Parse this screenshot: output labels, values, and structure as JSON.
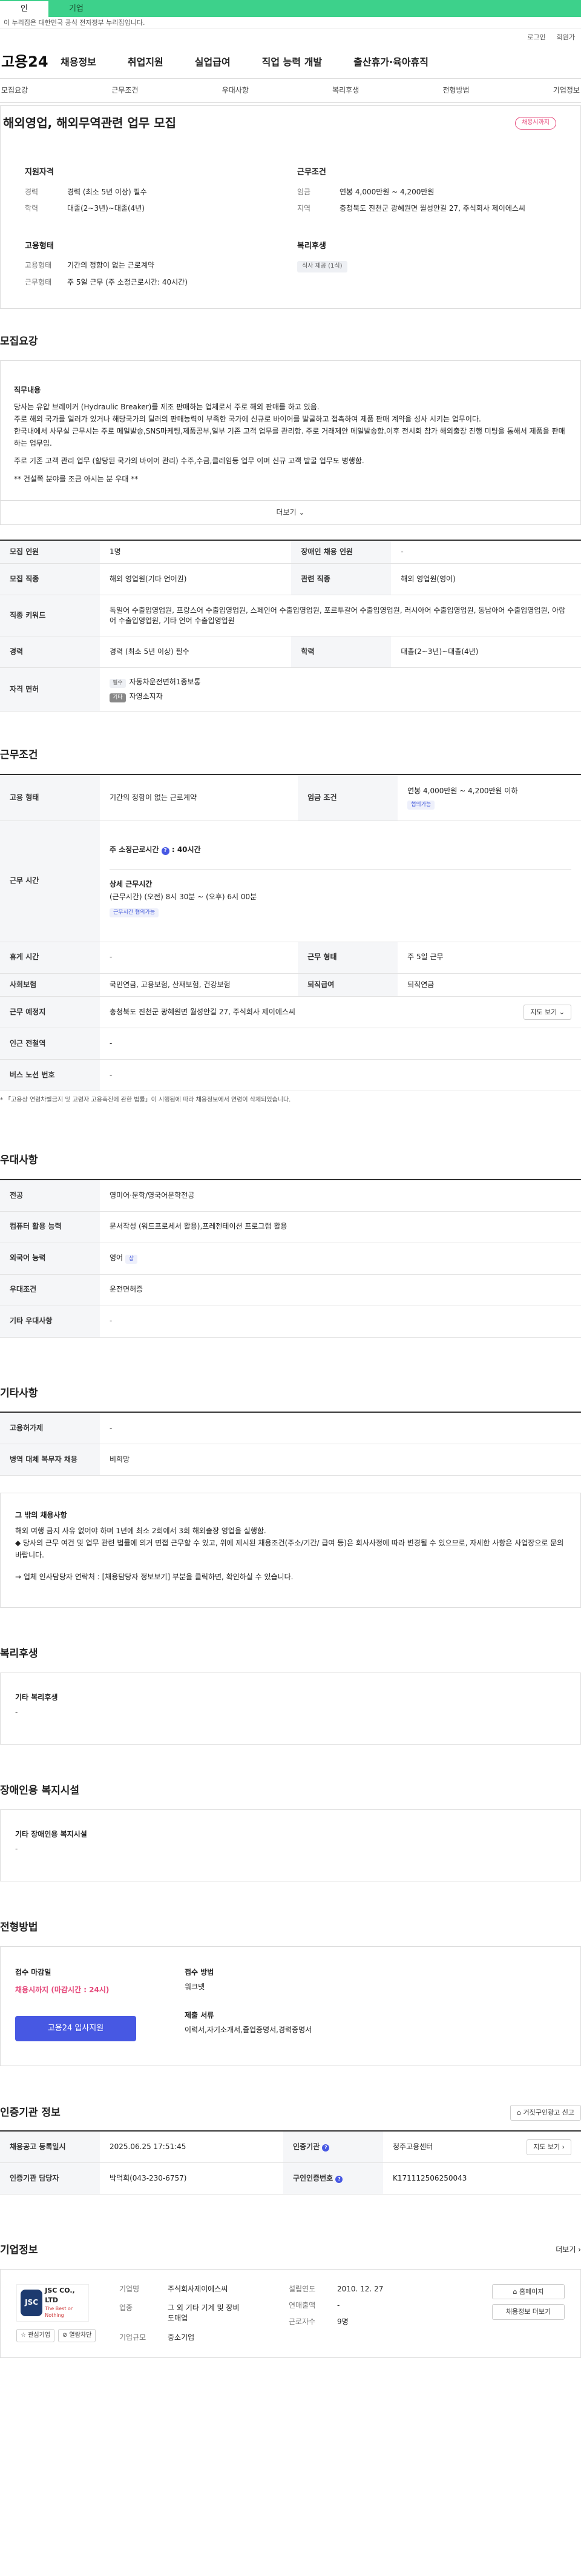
{
  "topbar": {
    "tab_individual": "인",
    "tab_company": "기업"
  },
  "notice": "이 누리집은 대한민국 공식 전자정부 누리집입니다.",
  "util": [
    "로그인",
    "회원가"
  ],
  "gnb": {
    "logo": "고용24",
    "items": [
      "채용정보",
      "취업지원",
      "실업급여",
      "직업 능력 개발",
      "출산휴가·육아휴직"
    ]
  },
  "subnav": [
    "모집요강",
    "근무조건",
    "우대사항",
    "복리후생",
    "전형방법",
    "기업정보"
  ],
  "hero": {
    "title": "해외영업, 해외무역관련 업무 모집",
    "badge": "채용시까지",
    "qual": {
      "heading": "지원자격",
      "rows": [
        {
          "k": "경력",
          "v": "경력 (최소 5년 이상) 필수"
        },
        {
          "k": "학력",
          "v": "대졸(2~3년)~대졸(4년)"
        }
      ]
    },
    "cond": {
      "heading": "근무조건",
      "rows": [
        {
          "k": "임금",
          "v": "연봉 4,000만원 ~ 4,200만원"
        },
        {
          "k": "지역",
          "v": "충청북도 진천군 광혜원면 월성안길 27, 주식회사 제이에스씨"
        }
      ]
    },
    "emp": {
      "heading": "고용형태",
      "rows": [
        {
          "k": "고용형태",
          "v": "기간의 정함이 없는 근로계약"
        },
        {
          "k": "근무형태",
          "v": "주 5일 근무 (주 소정근로시간: 40시간)"
        }
      ]
    },
    "welfare": {
      "heading": "복리후생",
      "chip": "식사 제공 (1식)"
    }
  },
  "recruit": {
    "heading": "모집요강",
    "duty_title": "직무내용",
    "duty_lines": [
      "당사는 유압 브레이커 (Hydraulic Breaker)를 제조 판매하는 업체로서 주로 해외 판매를 하고 있음.",
      "주로 해외 국가를 일러가 있거나 해당국가의 딜러의 판매능력이 부족한 국가에 신규로 바이어를 발굴하고 접촉하여 제품 판매 계약을 성사 시키는 업무이다.",
      "한국내에서 사무실 근무시는 주로 메일발송,SNS마케팅,제품공부,일부 기존 고객 업무를 관리함. 주로 거래제안 메일발송함.이후 전시회 참가 해외출장 진행 미팅을 통해서 제품을 판매하는 업무임.",
      "주로 기존 고객 관리 업무 (할당된 국가의 바이어 관리) 수주,수금,클레임등 업무 이며 신규 고객 발굴 업무도 병행함.",
      "** 건설쪽 분야를 조금 아시는 분 우대 **"
    ],
    "more": "더보기",
    "table": {
      "count_k": "모집 인원",
      "count_v": "1명",
      "disabled_k": "장애인 채용 인원",
      "disabled_v": "-",
      "job_k": "모집 직종",
      "job_v": "해외 영업원(기타 언어권)",
      "rel_k": "관련 직종",
      "rel_v": "해외 영업원(영어)",
      "kw_k": "직종 키워드",
      "kw_v": "독일어 수출입영업원, 프랑스어 수출입영업원, 스페인어 수출입영업원, 포르투갈어 수출입영업원, 러시아어 수출입영업원, 동남아어 수출입영업원, 아랍어 수출입영업원, 기타 언어 수출입영업원",
      "career_k": "경력",
      "career_v": "경력 (최소 5년 이상) 필수",
      "edu_k": "학력",
      "edu_v": "대졸(2~3년)~대졸(4년)",
      "lic_k": "자격 면허",
      "lic_rows": [
        {
          "chip": "필수",
          "text": "자동차운전면허1종보통"
        },
        {
          "chip": "기타",
          "text": "자영소지자"
        }
      ]
    }
  },
  "work": {
    "heading": "근무조건",
    "emp_k": "고용 형태",
    "emp_v": "기간의 정함이 없는 근로계약",
    "wage_k": "임금 조건",
    "wage_v": "연봉 4,000만원 ~ 4,200만원 이하",
    "wage_chip": "협의가능",
    "hours_k": "근무 시간",
    "hours_title": "주 소정근로시간",
    "hours_value": "40시간",
    "hours_detail_title": "상세 근무시간",
    "hours_detail": "(근무시간) (오전) 8시 30분 ~ (오후) 6시 00분",
    "hours_chip": "근무시간 협의가능",
    "break_k": "휴게 시간",
    "break_v": "-",
    "type_k": "근무 형태",
    "type_v": "주 5일 근무",
    "ins_k": "사회보험",
    "ins_v": "국민연금, 고용보험, 산재보험, 건강보험",
    "ret_k": "퇴직급여",
    "ret_v": "퇴직연금",
    "place_k": "근무 예정지",
    "place_v": "충청북도 진천군 광혜원면 월성안길 27, 주식회사 제이에스씨",
    "map_btn": "지도 보기",
    "sub_k": "인근 전철역",
    "sub_v": "-",
    "bus_k": "버스 노선 번호",
    "bus_v": "-",
    "foot": "* 「고용상 연령차별금지 및 고령자 고용촉진에 관한 법률」이 시행됨에 따라 채용정보에서 연령이 삭제되었습니다."
  },
  "pref": {
    "heading": "우대사항",
    "major_k": "전공",
    "major_v": "영미어·문학/영국어문학전공",
    "pc_k": "컴퓨터 활용 능력",
    "pc_v": "문서작성 (워드프로세서 활용),프레젠테이션 프로그램 활용",
    "lang_k": "외국어 능력",
    "lang_v": "영어",
    "lang_chip": "상",
    "cond_k": "우대조건",
    "cond_v": "운전면허증",
    "etc_k": "기타 우대사항",
    "etc_v": "-"
  },
  "etc": {
    "heading": "기타사항",
    "emp_k": "고용허가제",
    "emp_v": "-",
    "mil_k": "병역 대체 복무자 채용",
    "mil_v": "비희망",
    "box_title": "그 밖의 채용사항",
    "box_lines": [
      "해외 여행 금지 사유 없어야 하며 1년에 최소 2회에서 3회 해외출장 영업을 실행함.",
      "◆ 당사의 근무 여건 및 업무 관련 법률에 의거 면접 근무할 수 있고, 위에 제시된 채용조건(주소/기간/ 급여 등)은 회사사정에 따라 변경될 수 있으므로, 자세한 사항은 사업장으로 문의 바랍니다.",
      "→ 업체 인사담당자 연락처 : [채용담당자 정보보기] 부분을 클릭하면, 확인하실 수 있습니다."
    ]
  },
  "welfare": {
    "heading": "복리후생",
    "box_title": "기타 복리후생",
    "box_value": "-"
  },
  "disabled": {
    "heading": "장애인용 복지시설",
    "box_title": "기타 장애인용 복지시설",
    "box_value": "-"
  },
  "process": {
    "heading": "전형방법",
    "deadline_title": "접수 마감일",
    "deadline_value": "채용시까지 (마감시간 : 24시)",
    "apply_btn": "고용24 입사지원",
    "method_title": "접수 방법",
    "method_value": "워크넷",
    "docs_title": "제출 서류",
    "docs_value": "이력서,자기소개서,졸업증명서,경력증명서"
  },
  "agency": {
    "heading": "인증기관 정보",
    "report_btn": "거짓구인광고 신고",
    "reg_k": "채용공고 등록일시",
    "reg_v": "2025.06.25 17:51:45",
    "org_k": "인증기관",
    "org_v": "청주고용센터",
    "map_btn": "지도 보기",
    "mgr_k": "인증기관 담당자",
    "mgr_v": "박덕희(043-230-6757)",
    "no_k": "구인인증번호",
    "no_v": "K171112506250043"
  },
  "company": {
    "heading": "기업정보",
    "more": "더보기",
    "logo_mark": "JSC",
    "logo_name": "JSC CO., LTD",
    "logo_slogan": "The Best or Nothing",
    "fav_btn": "관심기업",
    "block_btn": "열람차단",
    "name_k": "기업명",
    "name_v": "주식회사제이에스씨",
    "ind_k": "업종",
    "ind_v": "그 외 기타 기계 및 장비 도매업",
    "size_k": "기업규모",
    "size_v": "중소기업",
    "est_k": "설립연도",
    "est_v": "2010. 12. 27",
    "sales_k": "연매출액",
    "sales_v": "-",
    "staff_k": "근로자수",
    "staff_v": "9명",
    "home_btn": "홈페이지",
    "jobs_btn": "채용정보 더보기"
  }
}
